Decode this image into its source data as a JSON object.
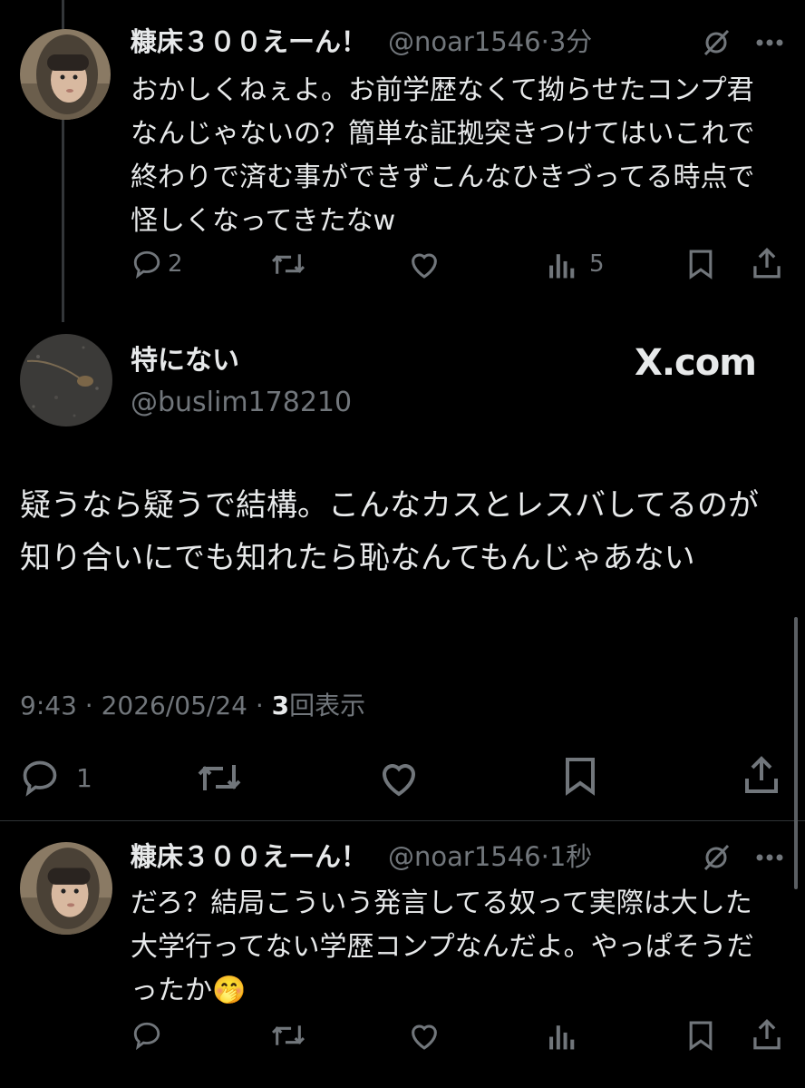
{
  "reply1": {
    "name": "糠床３００えーん！",
    "handle": "@noar1546",
    "time": "·3分",
    "text": "おかしくねぇよ。お前学歴なくて拗らせたコンプ君なんじゃないの？簡単な証拠突きつけてはいこれで終わりで済む事ができずこんなひきづってる時点で怪しくなってきたなw",
    "replies": "2",
    "views": "5"
  },
  "main": {
    "name": "特にない",
    "handle": "@buslim178210",
    "brand": "X.com",
    "text": "疑うなら疑うで結構。こんなカスとレスバしてるのが知り合いにでも知れたら恥なんてもんじゃあない",
    "timestamp": "9:43 · 2026/05/24 · ",
    "view_count": "3",
    "view_label": "回表示",
    "replies": "1"
  },
  "reply2": {
    "name": "糠床３００えーん！",
    "handle": "@noar1546",
    "time": "·1秒",
    "text": "だろ？結局こういう発言してる奴って実際は大した大学行ってない学歴コンプなんだよ。やっぱそうだったか",
    "emoji": "🤭"
  },
  "icons": [
    "reply-icon",
    "repost-icon",
    "like-icon",
    "views-icon",
    "bookmark-icon",
    "share-icon",
    "grok-icon",
    "more-icon"
  ],
  "colors": {
    "background": "#000000",
    "text": "#e7e9ea",
    "muted": "#71767b",
    "divider": "#2f3336"
  }
}
